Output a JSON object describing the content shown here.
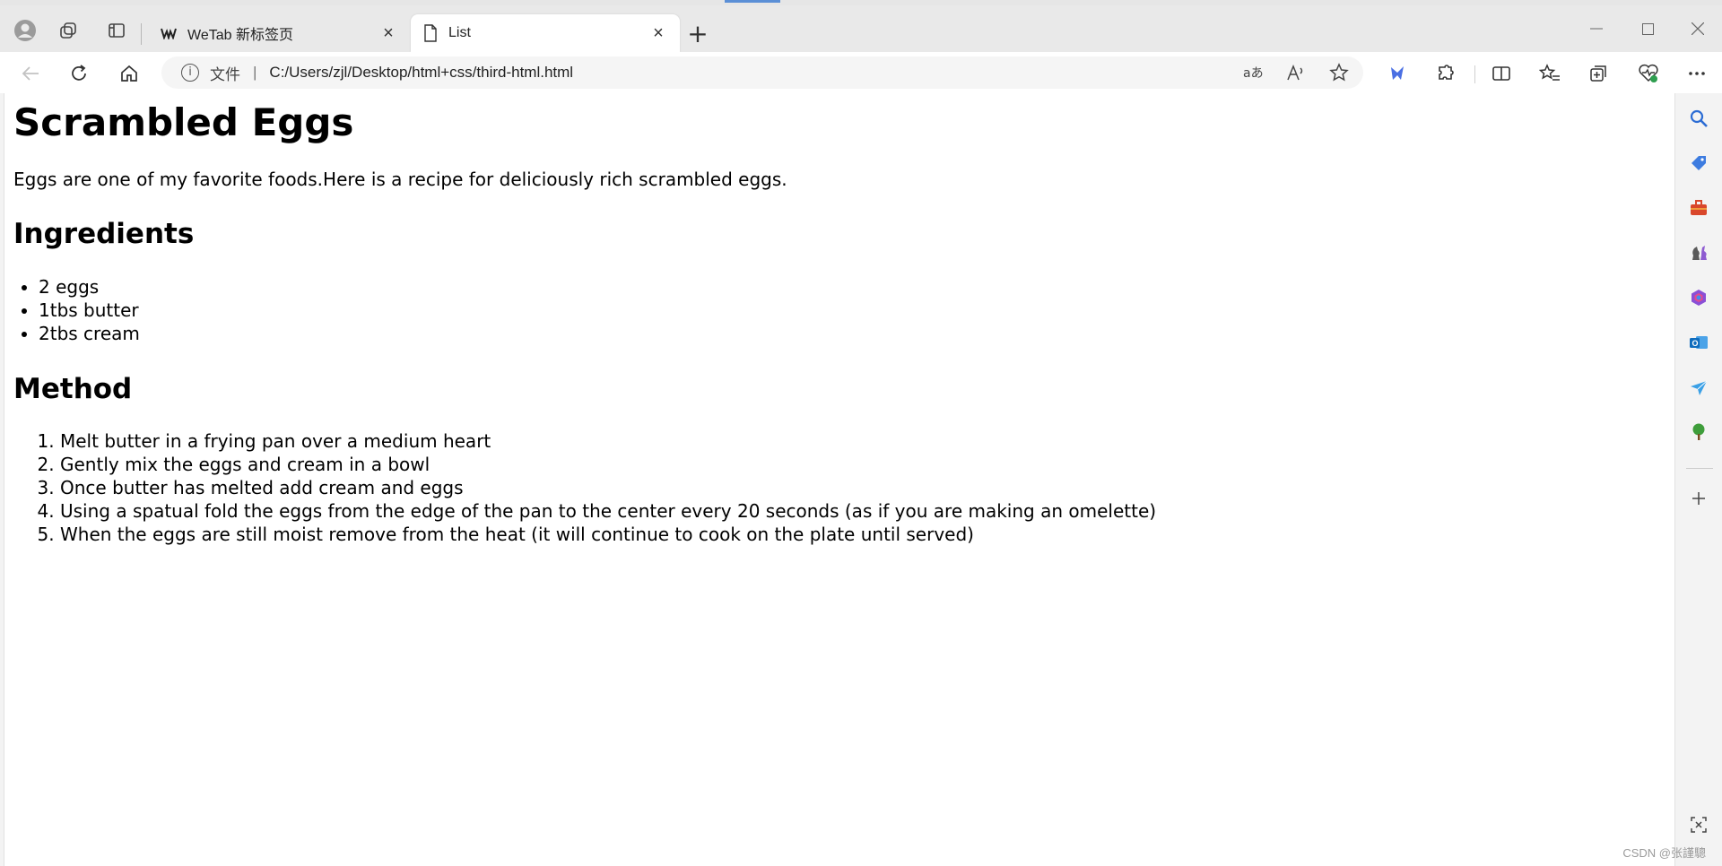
{
  "browser": {
    "tabs": [
      {
        "title": "WeTab 新标签页"
      },
      {
        "title": "List"
      }
    ],
    "new_tab_symbol": "+",
    "close_symbol": "×",
    "address": {
      "scheme_label": "文件",
      "separator": "|",
      "url": "C:/Users/zjl/Desktop/html+css/third-html.html"
    }
  },
  "page": {
    "title": "Scrambled Eggs",
    "intro": "Eggs are one of my favorite foods.Here is a recipe for deliciously rich scrambled eggs.",
    "ingredients_heading": "Ingredients",
    "ingredients": [
      "2 eggs",
      "1tbs butter",
      "2tbs cream"
    ],
    "method_heading": "Method",
    "method": [
      "Melt butter in a frying pan over a medium heart",
      "Gently mix the eggs and cream in a bowl",
      "Once butter has melted add cream and eggs",
      "Using a spatual fold the eggs from the edge of the pan to the center every 20 seconds (as if you are making an omelette)",
      "When the eggs are still moist remove from the heat (it will continue to cook on the plate until served)"
    ]
  },
  "watermark": "CSDN @张謹驄",
  "icons": {
    "profile": "profile-icon",
    "workspaces": "workspaces-icon",
    "vertical_tabs": "vertical-tabs-icon",
    "back": "back-arrow-icon",
    "refresh": "refresh-icon",
    "home": "home-icon",
    "info": "info-icon",
    "read_aloud": "read-aloud-icon",
    "translate": "translate-icon",
    "favorite": "star-icon",
    "extensions": "extensions-icon",
    "split_screen": "split-screen-icon",
    "favorites": "favorites-icon",
    "collections": "collections-icon",
    "performance": "performance-icon",
    "more": "more-icon"
  },
  "colors": {
    "link_accent": "#5b8fd6",
    "tab_active": "#ffffff",
    "tab_strip": "#e9e9e9"
  }
}
